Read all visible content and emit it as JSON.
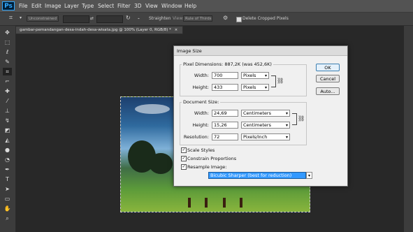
{
  "app": {
    "logo": "Ps"
  },
  "menu": [
    "File",
    "Edit",
    "Image",
    "Layer",
    "Type",
    "Select",
    "Filter",
    "3D",
    "View",
    "Window",
    "Help"
  ],
  "options": {
    "constraint": "Unconstrained",
    "straighten": "Straighten",
    "view_label": "View:",
    "view_value": "Rule of Thirds",
    "delete_cropped": "Delete Cropped Pixels"
  },
  "document": {
    "tab_title": "gambar-pemandangan-desa-indah-desa-wisata.jpg @ 100% (Layer 0, RGB/8) *",
    "close": "×"
  },
  "dialog": {
    "title": "Image Size",
    "pixel_dimensions_label": "Pixel Dimensions:",
    "pixel_dimensions_value": "887,2K (was 452,6K)",
    "width_label": "Width:",
    "height_label": "Height:",
    "px_width": "700",
    "px_height": "433",
    "px_width_unit": "Pixels",
    "px_height_unit": "Pixels",
    "document_size_label": "Document Size:",
    "doc_width": "24,69",
    "doc_height": "15,26",
    "doc_width_unit": "Centimeters",
    "doc_height_unit": "Centimeters",
    "resolution_label": "Resolution:",
    "resolution": "72",
    "resolution_unit": "Pixels/Inch",
    "scale_styles": "Scale Styles",
    "constrain_proportions": "Constrain Proportions",
    "resample_image": "Resample Image:",
    "resample_method": "Bicubic Sharper (best for reduction)",
    "ok": "OK",
    "cancel": "Cancel",
    "auto": "Auto..."
  }
}
